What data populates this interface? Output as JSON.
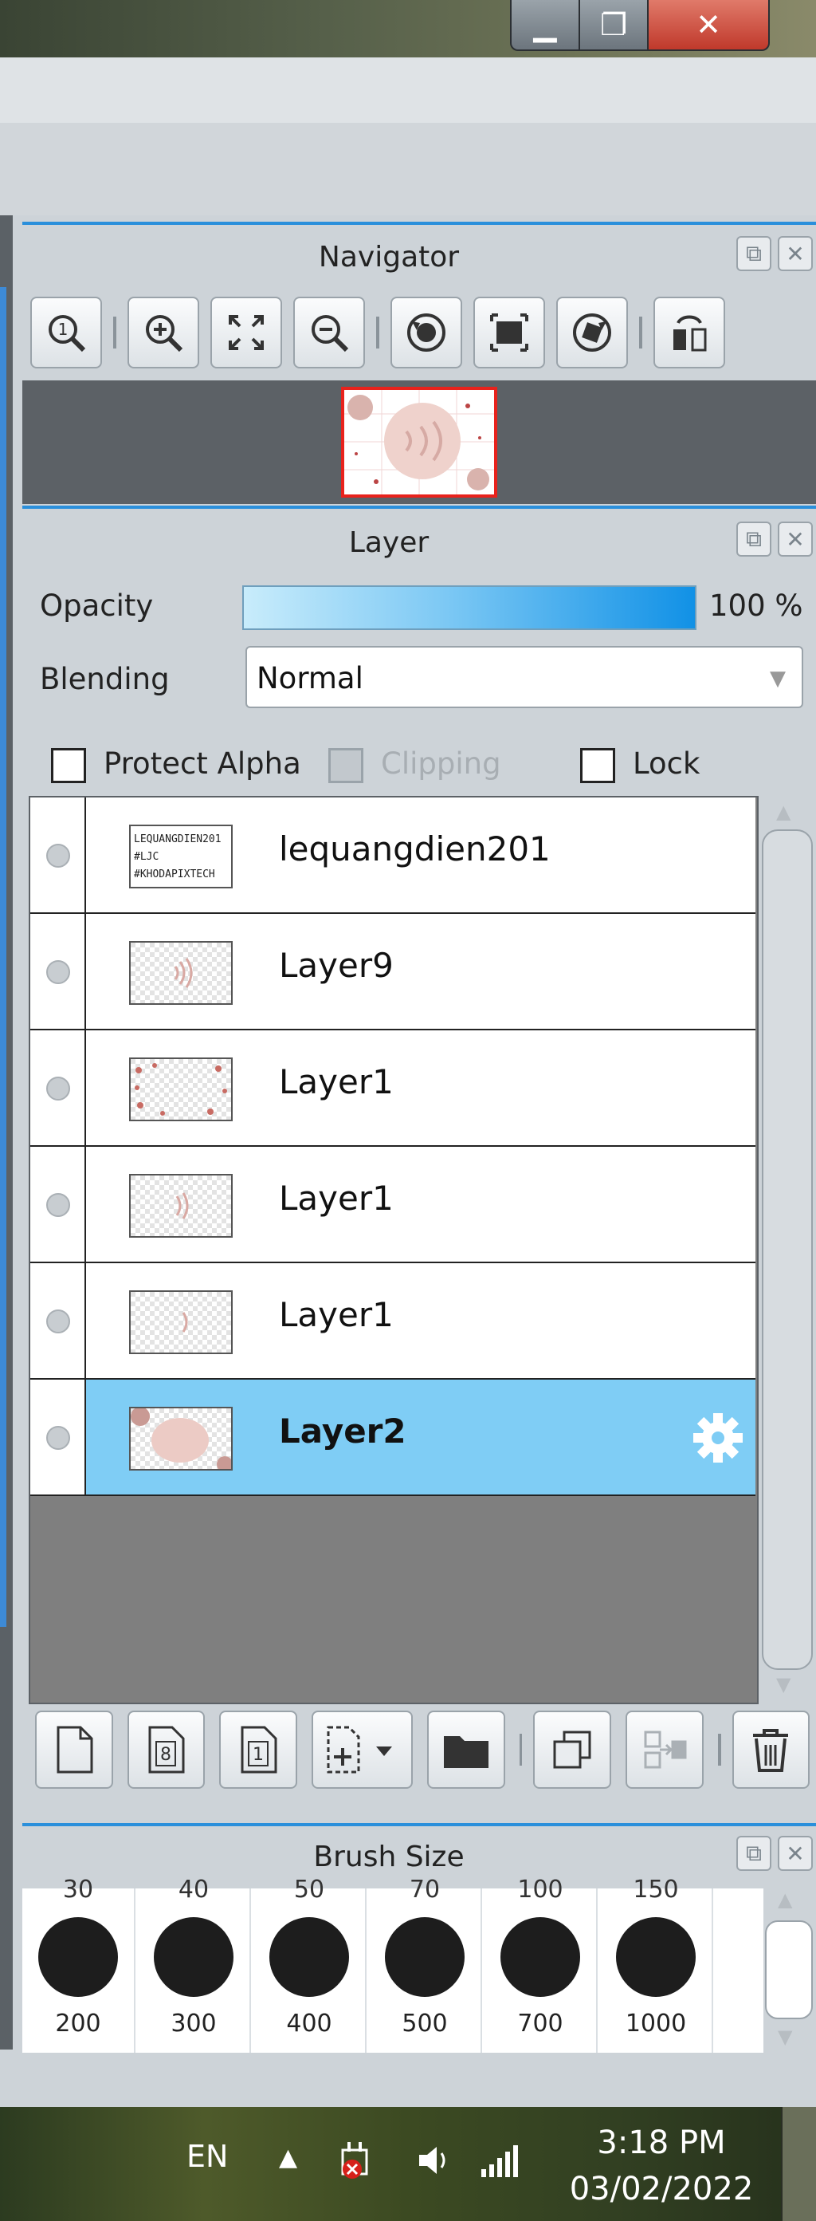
{
  "window": {
    "minimize": "▁",
    "maximize": "❐",
    "close": "✕"
  },
  "navigator": {
    "title": "Navigator",
    "buttons": [
      "zoom-actual-icon",
      "zoom-in-icon",
      "fit-screen-icon",
      "zoom-out-icon",
      "rotate-left-icon",
      "fit-canvas-icon",
      "rotate-right-icon",
      "flip-horizontal-icon"
    ]
  },
  "layer_panel": {
    "title": "Layer",
    "opacity_label": "Opacity",
    "opacity_value": "100 %",
    "opacity_fraction": 1.0,
    "blending_label": "Blending",
    "blending_value": "Normal",
    "protect_alpha": "Protect Alpha",
    "clipping": "Clipping",
    "lock": "Lock",
    "layers": [
      {
        "name": "lequangdien201",
        "selected": false
      },
      {
        "name": "Layer9",
        "selected": false
      },
      {
        "name": "Layer1",
        "selected": false
      },
      {
        "name": "Layer1",
        "selected": false
      },
      {
        "name": "Layer1",
        "selected": false
      },
      {
        "name": "Layer2",
        "selected": true
      }
    ],
    "thumb_text": [
      "LEQUANGDIEN201",
      "#LJC",
      "#KHODAPIXTECH"
    ],
    "footer_buttons": [
      "new-layer-icon",
      "new-8bit-layer-icon",
      "new-1bit-layer-icon",
      "add-layer-menu-icon",
      "new-folder-icon",
      "duplicate-layer-icon",
      "merge-layer-icon",
      "delete-layer-icon"
    ]
  },
  "brush_size": {
    "title": "Brush Size",
    "top_values": [
      "30",
      "40",
      "50",
      "70",
      "100",
      "150"
    ],
    "bottom_values": [
      "200",
      "300",
      "400",
      "500",
      "700",
      "1000"
    ]
  },
  "taskbar": {
    "language": "EN",
    "time": "3:18 PM",
    "date": "03/02/2022"
  },
  "colors": {
    "accent": "#2a8fdb",
    "selected_row": "#7fcdf5",
    "close_red": "#c0392b",
    "navigator_frame": "#e8221c"
  }
}
